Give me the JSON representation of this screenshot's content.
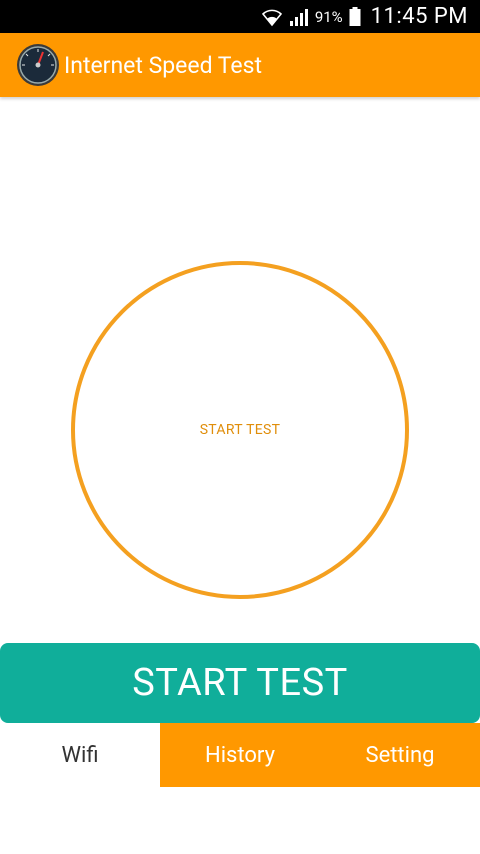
{
  "status_bar": {
    "wifi_icon": "wifi-icon",
    "signal_icon": "cell-signal-icon",
    "battery_percent": "91%",
    "battery_icon": "battery-icon",
    "time": "11:45 PM"
  },
  "toolbar": {
    "logo_icon": "speedometer-icon",
    "title": "Internet Speed Test"
  },
  "ring": {
    "label": "START TEST"
  },
  "start_button": {
    "label": "START TEST"
  },
  "tabs": [
    {
      "label": "Wifi",
      "active": true
    },
    {
      "label": "History",
      "active": false
    },
    {
      "label": "Setting",
      "active": false
    }
  ],
  "colors": {
    "toolbar": "#ff9800",
    "ring": "#f4a020",
    "ring_text": "#e08e0b",
    "button": "#10ae9a",
    "tab_active_bg": "#ffffff",
    "tab_inactive_bg": "#ff9800"
  }
}
